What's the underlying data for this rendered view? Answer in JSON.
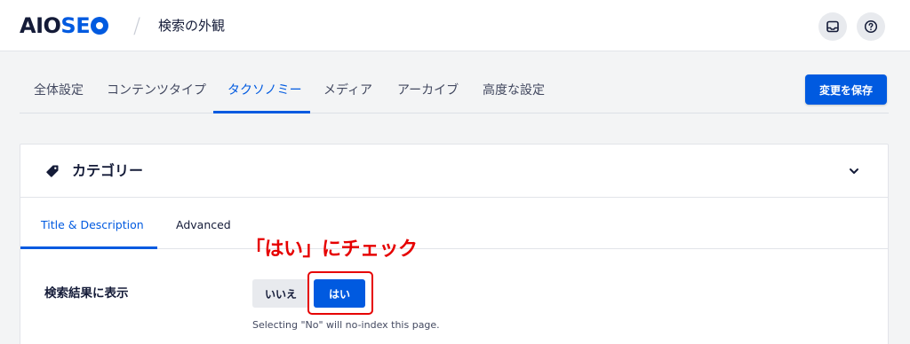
{
  "header": {
    "logo_aio": "AIO",
    "logo_seo": "SE",
    "separator": "/",
    "page_title": "検索の外観"
  },
  "tabs": [
    {
      "label": "全体設定"
    },
    {
      "label": "コンテンツタイプ"
    },
    {
      "label": "タクソノミー",
      "active": true
    },
    {
      "label": "メディア"
    },
    {
      "label": "アーカイブ"
    },
    {
      "label": "高度な設定"
    }
  ],
  "save_label": "変更を保存",
  "card": {
    "title": "カテゴリー",
    "sub_tabs": [
      {
        "label": "Title & Description",
        "active": true
      },
      {
        "label": "Advanced"
      }
    ],
    "setting": {
      "label": "検索結果に表示",
      "options": [
        "いいえ",
        "はい"
      ],
      "selected": "はい",
      "hint": "Selecting \"No\" will no-index this page."
    }
  },
  "annotation": "「はい」にチェック",
  "colors": {
    "accent": "#005ae0",
    "annotation": "#e60000"
  },
  "icons": {
    "inbox": "inbox-icon",
    "help": "help-icon",
    "tag": "tag-icon",
    "chevron": "chevron-down-icon"
  }
}
